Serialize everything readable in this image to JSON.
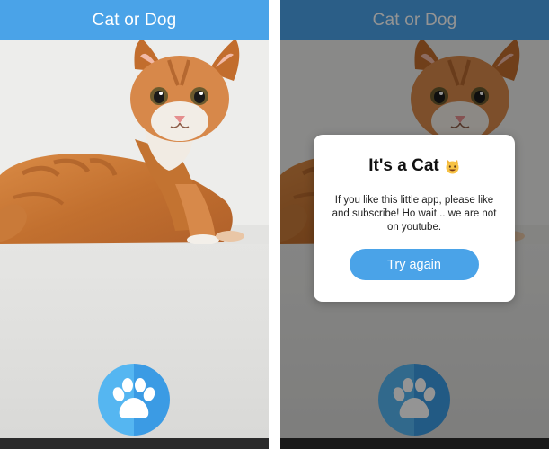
{
  "app": {
    "title": "Cat or Dog"
  },
  "screens": [
    {
      "id": "camera-screen",
      "photo": "cat-photo",
      "action_icon": "paw-icon"
    },
    {
      "id": "result-screen",
      "photo": "cat-photo",
      "action_icon": "paw-icon"
    }
  ],
  "result_dialog": {
    "title": "It's a Cat",
    "title_icon": "smiling-cat-emoji",
    "message": "If you like this little app, please like and subscribe! Ho wait... we are not on youtube.",
    "button_label": "Try again"
  },
  "colors": {
    "accent": "#4aa3e8",
    "paw_button_light": "#55b6f1",
    "paw_button_dark": "#3b9be4",
    "overlay": "rgba(0,0,0,0.42)"
  }
}
